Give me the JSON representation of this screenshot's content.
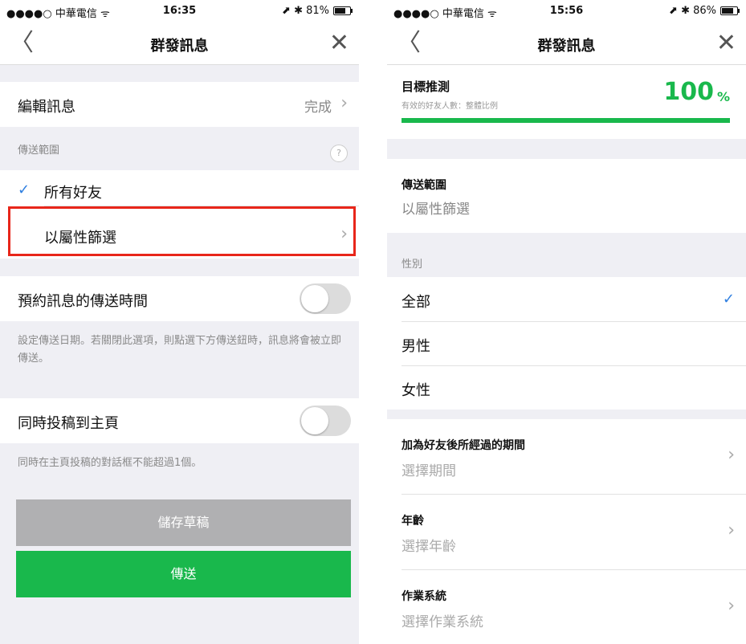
{
  "left": {
    "status": {
      "carrier": "●●●●○ 中華電信 ᯤ",
      "time": "16:35",
      "right": "⬈ ✱ 81%",
      "battery_level": 0.81
    },
    "nav": {
      "back": "〈",
      "title": "群發訊息",
      "close": "✕"
    },
    "edit_row": {
      "label": "編輯訊息",
      "value": "完成",
      "chevron": "›"
    },
    "scope": {
      "header": "傳送範圍",
      "help": "?",
      "all_friends": "所有好友",
      "check": "✓",
      "filter": "以屬性篩選",
      "chevron": "›"
    },
    "schedule": {
      "label": "預約訊息的傳送時間",
      "on": false,
      "note": "設定傳送日期。若關閉此選項，則點選下方傳送鈕時，訊息將會被立即傳送。"
    },
    "home": {
      "label": "同時投稿到主頁",
      "on": false,
      "note": "同時在主頁投稿的對話框不能超過1個。"
    },
    "buttons": {
      "save_draft": "儲存草稿",
      "send": "傳送"
    },
    "colors": {
      "green": "#19b84c",
      "gray_button": "#b0b0b2",
      "highlight": "#e8261a",
      "check": "#2f7fe0"
    }
  },
  "right": {
    "status": {
      "carrier": "●●●●○ 中華電信 ᯤ",
      "time": "15:56",
      "right": "⬈ ✱ 86%",
      "battery_level": 0.86
    },
    "nav": {
      "back": "〈",
      "title": "群發訊息",
      "close": "✕"
    },
    "target": {
      "title": "目標推測",
      "subtitle": "有效的好友人數：整體比例",
      "percent_number": "100",
      "percent_sign": "%",
      "progress": 1.0
    },
    "scope": {
      "label": "傳送範圍",
      "value": "以屬性篩選"
    },
    "gender": {
      "header": "性別",
      "options": [
        "全部",
        "男性",
        "女性"
      ],
      "selected": "全部",
      "check": "✓"
    },
    "period": {
      "label": "加為好友後所經過的期間",
      "placeholder": "選擇期間",
      "chevron": "›"
    },
    "age": {
      "label": "年齡",
      "placeholder": "選擇年齡",
      "chevron": "›"
    },
    "os": {
      "label": "作業系統",
      "placeholder": "選擇作業系統",
      "chevron": "›"
    }
  }
}
